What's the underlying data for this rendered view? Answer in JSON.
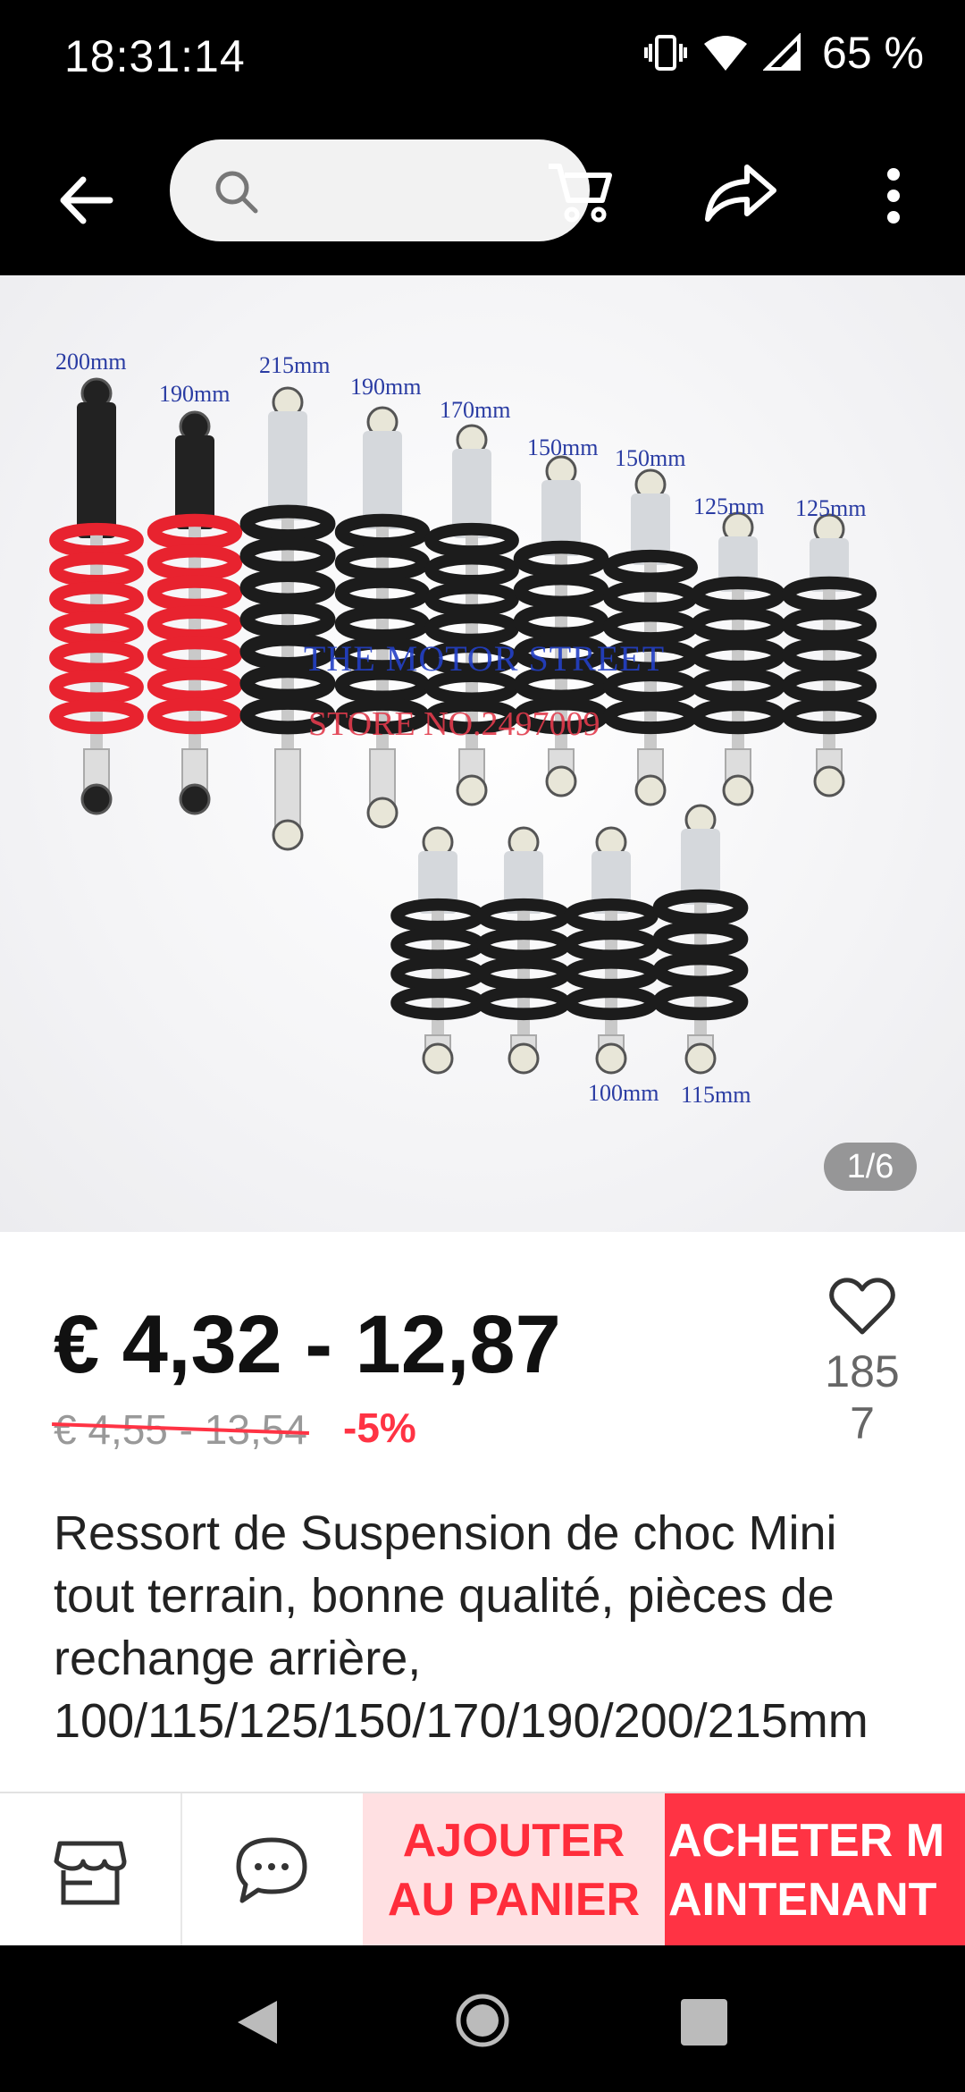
{
  "status": {
    "time": "18:31:14",
    "battery": "65 %"
  },
  "icons": {
    "back": "arrow-left-icon",
    "search": "search-icon",
    "cart": "cart-icon",
    "share": "share-icon",
    "more": "more-vertical-icon",
    "wishlist": "heart-icon",
    "store": "store-icon",
    "chat": "chat-icon"
  },
  "search": {
    "placeholder": ""
  },
  "gallery": {
    "counter": "1/6",
    "watermark_line1": "THE MOTOR STREET",
    "watermark_line2": "STORE NO.2497009",
    "dimension_labels": [
      "200mm",
      "190mm",
      "215mm",
      "190mm",
      "170mm",
      "150mm",
      "150mm",
      "125mm",
      "125mm",
      "100mm",
      "115mm"
    ]
  },
  "product": {
    "price": "€ 4,32 - 12,87",
    "old_price": "€ 4,55 - 13,54",
    "discount": "-5%",
    "wishlist_count": "1857",
    "title": "Ressort de Suspension de choc Mini tout terrain, bonne qualité, pièces de rechange arrière, 100/115/125/150/170/190/200/215mm"
  },
  "actions": {
    "add_to_cart_line1": "AJOUTER",
    "add_to_cart_line2": "AU PANIER",
    "buy_now_line1": "ACHETER M",
    "buy_now_line2": "AINTENANT"
  },
  "colors": {
    "accent": "#ff3344",
    "accent_light": "#ffe0e2",
    "dimension_text": "#2a3ca3"
  }
}
